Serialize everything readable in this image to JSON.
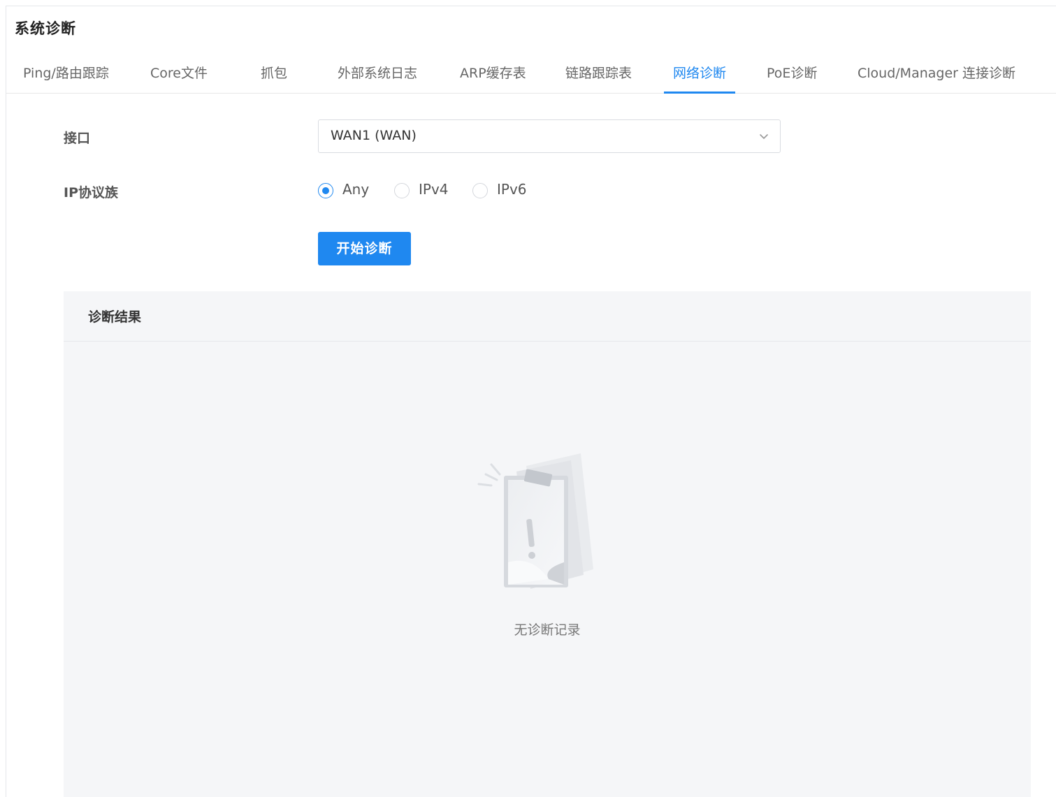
{
  "page": {
    "title": "系统诊断"
  },
  "tabs": [
    {
      "label": "Ping/路由跟踪",
      "active": false
    },
    {
      "label": "Core文件",
      "active": false
    },
    {
      "label": "抓包",
      "active": false
    },
    {
      "label": "外部系统日志",
      "active": false
    },
    {
      "label": "ARP缓存表",
      "active": false
    },
    {
      "label": "链路跟踪表",
      "active": false
    },
    {
      "label": "网络诊断",
      "active": true
    },
    {
      "label": "PoE诊断",
      "active": false
    },
    {
      "label": "Cloud/Manager 连接诊断",
      "active": false
    }
  ],
  "form": {
    "interface": {
      "label": "接口",
      "value": "WAN1 (WAN)",
      "icon": "chevron-down-icon"
    },
    "ip_family": {
      "label": "IP协议族",
      "options": [
        {
          "label": "Any",
          "checked": true
        },
        {
          "label": "IPv4",
          "checked": false
        },
        {
          "label": "IPv6",
          "checked": false
        }
      ]
    },
    "start_button": "开始诊断"
  },
  "results": {
    "title": "诊断结果",
    "empty_text": "无诊断记录",
    "empty_icon": "empty-clipboard-warning-icon"
  },
  "colors": {
    "accent": "#1f88f0",
    "panel_bg": "#f5f6f8",
    "border": "#d9dce1"
  }
}
